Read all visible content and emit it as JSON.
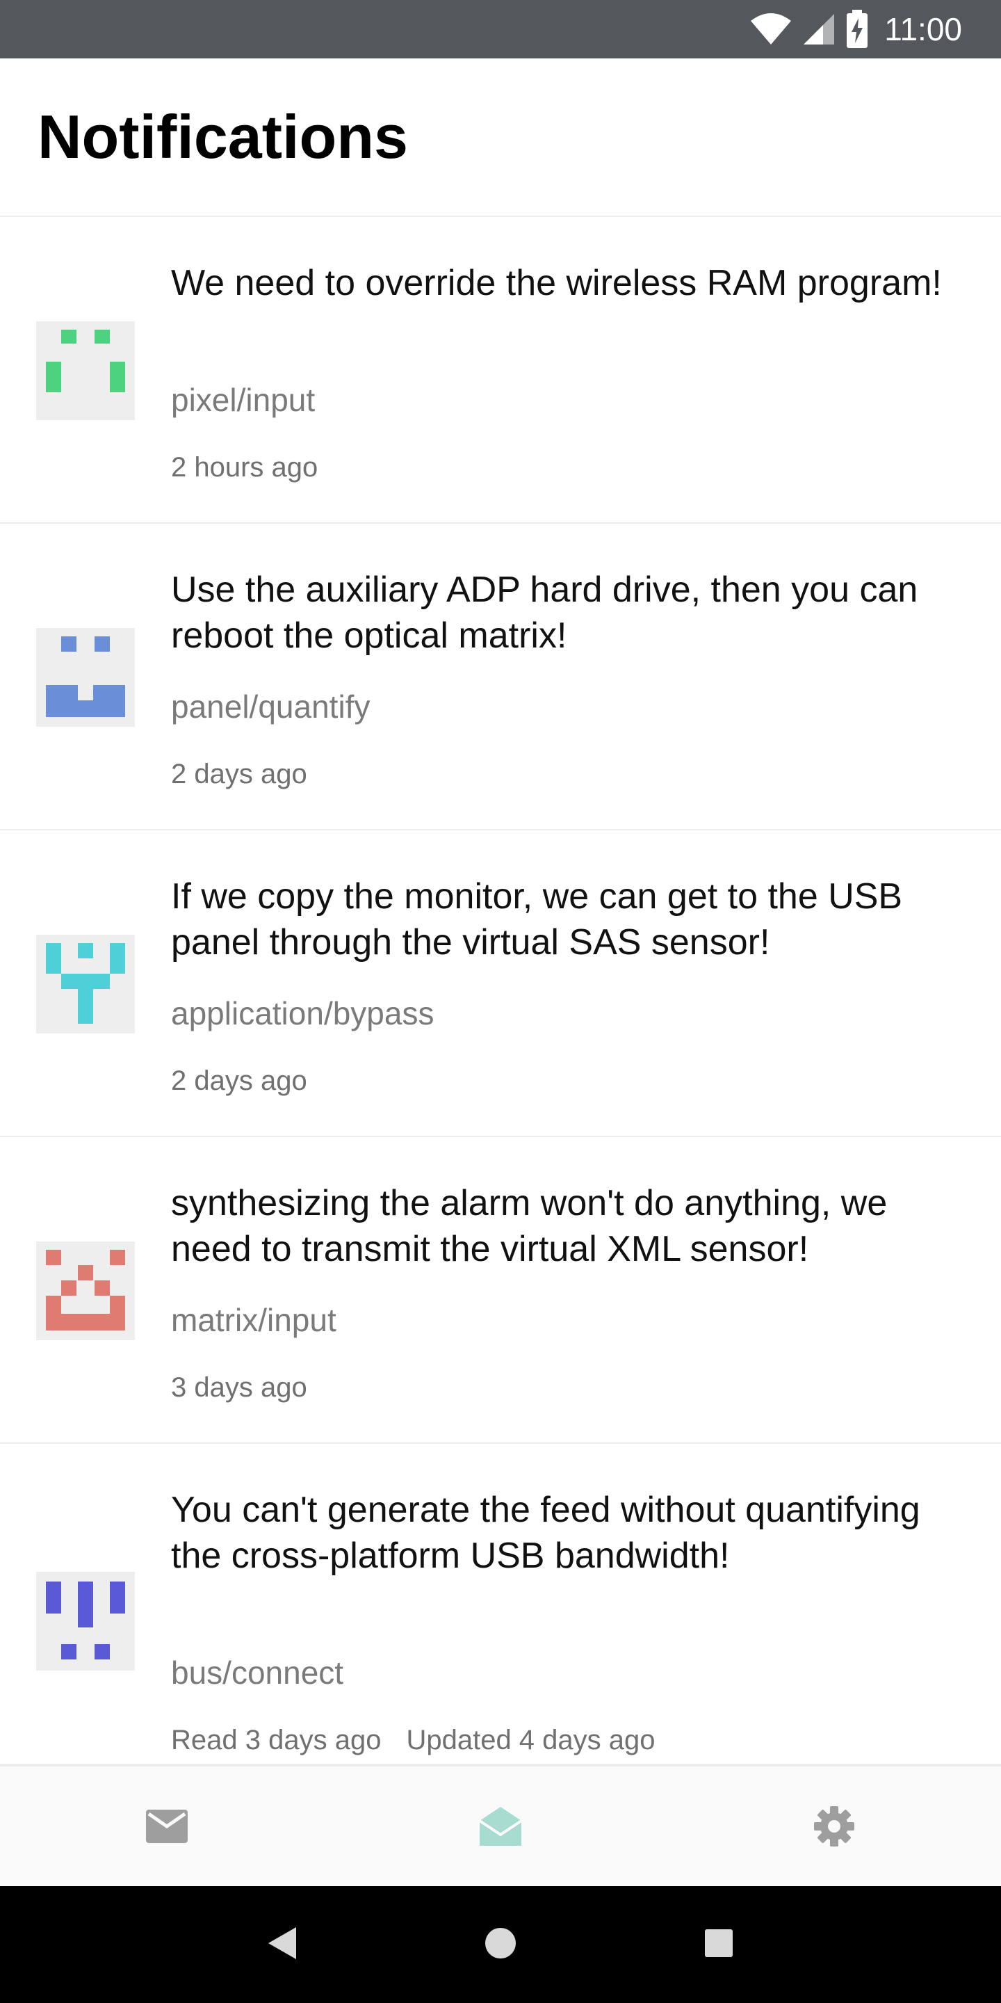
{
  "status_bar": {
    "time": "11:00",
    "icons": [
      "wifi-icon",
      "signal-icon",
      "battery-charging-icon"
    ]
  },
  "header": {
    "title": "Notifications"
  },
  "notifications": [
    {
      "message": "We need to override the wireless RAM program!",
      "topic": "pixel/input",
      "time": "2 hours ago",
      "avatar_color": "#4dd27f"
    },
    {
      "message": "Use the auxiliary ADP hard drive, then you can reboot the optical matrix!",
      "topic": "panel/quantify",
      "time": "2 days ago",
      "avatar_color": "#6a8fd8"
    },
    {
      "message": "If we copy the monitor, we can get to the USB panel through the virtual SAS sensor!",
      "topic": "application/bypass",
      "time": "2 days ago",
      "avatar_color": "#4fcfd8"
    },
    {
      "message": "synthesizing the alarm won't do anything, we need to transmit the virtual XML sensor!",
      "topic": "matrix/input",
      "time": "3 days ago",
      "avatar_color": "#e07b72"
    },
    {
      "message": "You can't generate the feed without quantifying the cross-platform USB bandwidth!",
      "topic": "bus/connect",
      "time": "Read 3 days ago",
      "time_updated": "Updated 4 days ago",
      "avatar_color": "#5a5ad6"
    }
  ],
  "bottom_nav": {
    "items": [
      {
        "icon": "mail-icon",
        "active": false
      },
      {
        "icon": "mail-open-icon",
        "active": true
      },
      {
        "icon": "settings-icon",
        "active": false
      }
    ],
    "active_color": "#a9dcd0",
    "inactive_color": "#9e9e9e"
  },
  "system_nav": {
    "icons": [
      "back-icon",
      "home-icon",
      "recents-icon"
    ]
  }
}
